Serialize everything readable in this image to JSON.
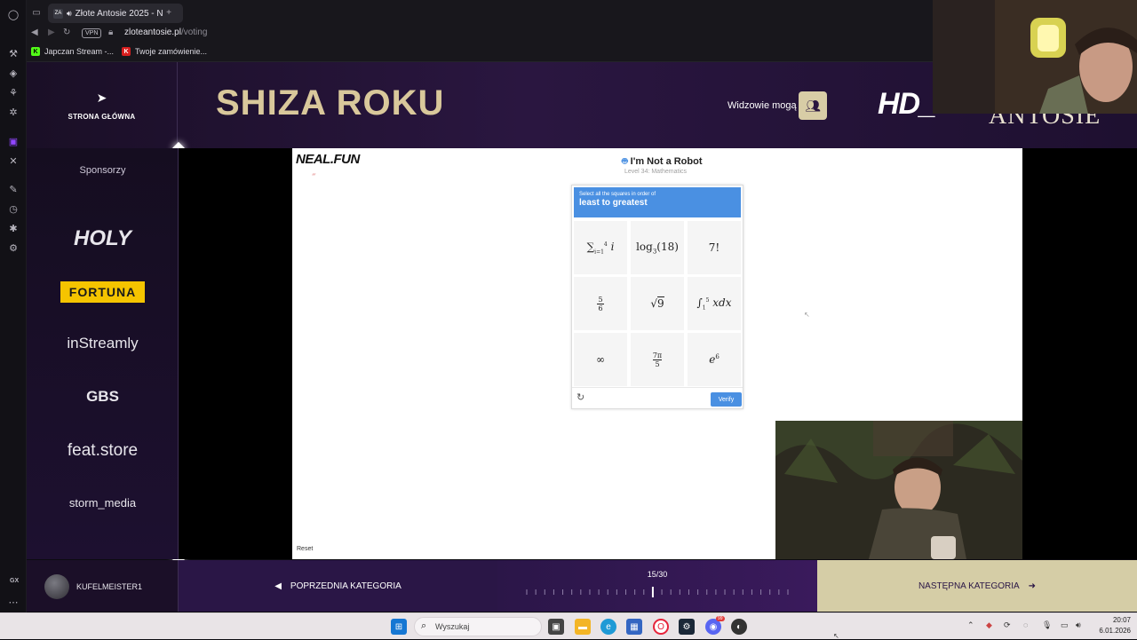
{
  "browser": {
    "tab_title": "Złote Antosie 2025 - N",
    "tab_favicon_text": "ZA",
    "vpn_label": "VPN",
    "url_domain": "zloteantosie.pl",
    "url_path": "/voting",
    "bookmarks": [
      {
        "label": "Japczan Stream -...",
        "color": "#53fc18"
      },
      {
        "label": "Twoje zamówienie...",
        "color": "#d81e1e"
      }
    ]
  },
  "header": {
    "home_label": "STRONA GŁÓWNA",
    "category_title": "SHIZA ROKU",
    "viewers_label": "Widzowie mogą",
    "logo_hd": "HD_",
    "logo_antosie": "ANTOSIE"
  },
  "sponsors": {
    "title": "Sponsorzy",
    "items": [
      "HOLY",
      "FORTUNA",
      "inStreamly",
      "GBS",
      "feat.store",
      "storm_media"
    ]
  },
  "game": {
    "site_logo": "NEAL.FUN",
    "title": "I'm Not a Robot",
    "subtitle": "Level 34: Mathematics",
    "captcha": {
      "instruction": "Select all the squares in order of",
      "target": "least to greatest",
      "verify_label": "Verify"
    },
    "reset_label": "Reset"
  },
  "footer": {
    "username": "KUFELMEISTER1",
    "prev_label": "POPRZEDNIA KATEGORIA",
    "progress_label": "15/30",
    "progress_current": 15,
    "progress_total": 30,
    "next_label": "NASTĘPNA KATEGORIA",
    "gx_label": "GX"
  },
  "taskbar": {
    "search_placeholder": "Wyszukaj",
    "time": "20:07",
    "date": "6.01.2026",
    "discord_badge": "99"
  }
}
